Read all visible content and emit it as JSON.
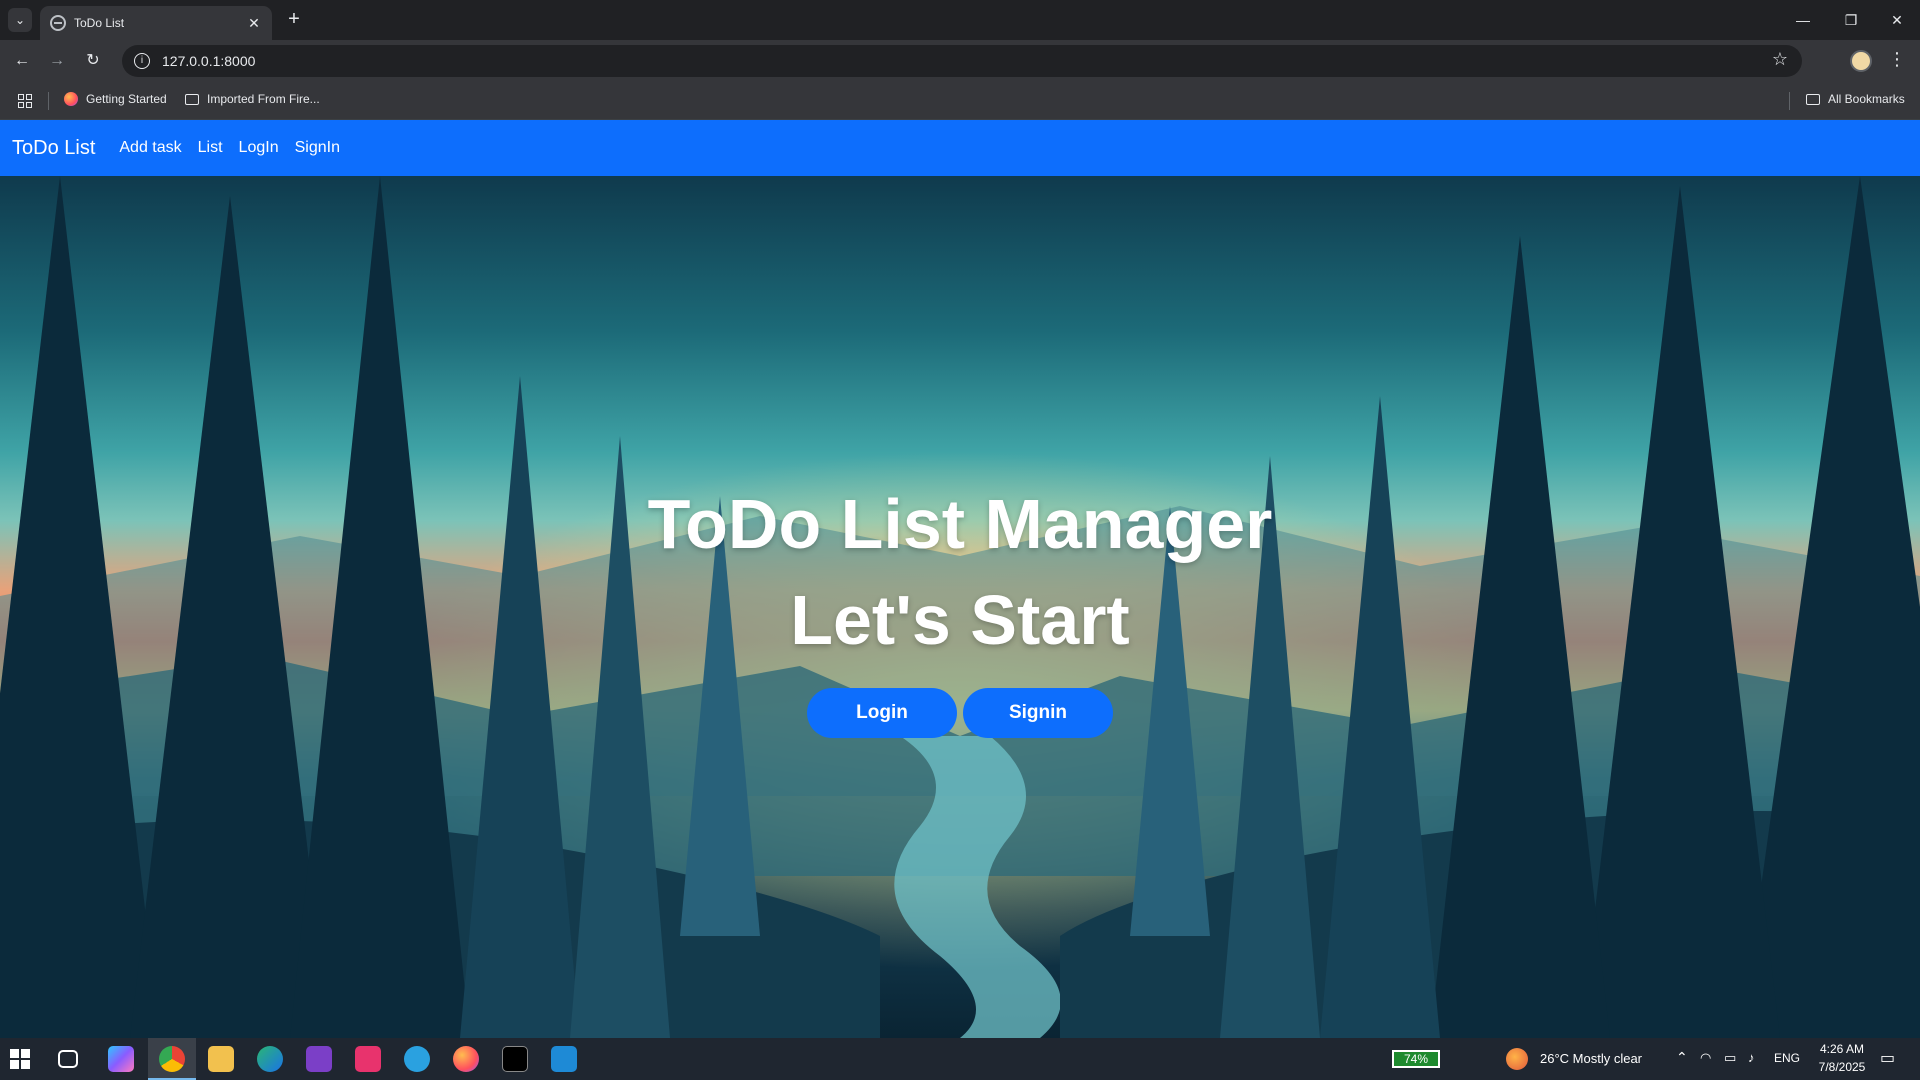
{
  "browser": {
    "tab_title": "ToDo List",
    "url": "127.0.0.1:8000",
    "bookmarks": [
      "Getting Started",
      "Imported From Fire...",
      "All Bookmarks"
    ]
  },
  "app": {
    "brand": "ToDo List",
    "nav": [
      "Add task",
      "List",
      "LogIn",
      "SignIn"
    ],
    "hero_line1": "ToDo List Manager",
    "hero_line2": "Let's Start",
    "login_label": "Login",
    "signin_label": "Signin",
    "accent": "#0d6efd"
  },
  "taskbar": {
    "battery": "74%",
    "weather": "26°C  Mostly clear",
    "lang": "ENG",
    "time": "4:26 AM",
    "date": "7/8/2025"
  }
}
